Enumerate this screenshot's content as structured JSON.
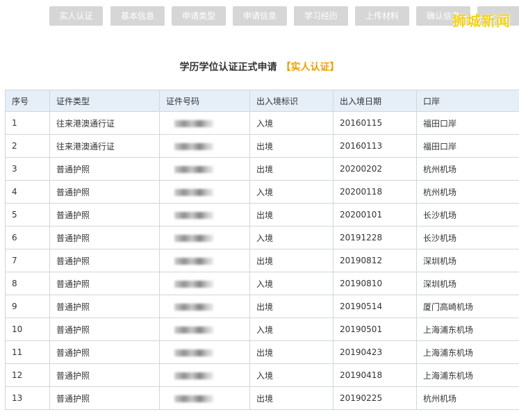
{
  "steps": [
    "实人认证",
    "基本信息",
    "申请类型",
    "申请信息",
    "学习经历",
    "上传材料",
    "确认信息"
  ],
  "watermark": "狮城新闻",
  "title": {
    "main": "学历学位认证正式申请",
    "tag": "【实人认证】"
  },
  "table": {
    "headers": [
      "序号",
      "证件类型",
      "证件号码",
      "出入境标识",
      "出入境日期",
      "口岸"
    ],
    "rows": [
      {
        "no": "1",
        "type": "往来港澳通行证",
        "flag": "入境",
        "date": "20160115",
        "port": "福田口岸"
      },
      {
        "no": "2",
        "type": "往来港澳通行证",
        "flag": "出境",
        "date": "20160113",
        "port": "福田口岸"
      },
      {
        "no": "3",
        "type": "普通护照",
        "flag": "出境",
        "date": "20200202",
        "port": "杭州机场"
      },
      {
        "no": "4",
        "type": "普通护照",
        "flag": "入境",
        "date": "20200118",
        "port": "杭州机场"
      },
      {
        "no": "5",
        "type": "普通护照",
        "flag": "出境",
        "date": "20200101",
        "port": "长沙机场"
      },
      {
        "no": "6",
        "type": "普通护照",
        "flag": "入境",
        "date": "20191228",
        "port": "长沙机场"
      },
      {
        "no": "7",
        "type": "普通护照",
        "flag": "出境",
        "date": "20190812",
        "port": "深圳机场"
      },
      {
        "no": "8",
        "type": "普通护照",
        "flag": "入境",
        "date": "20190810",
        "port": "深圳机场"
      },
      {
        "no": "9",
        "type": "普通护照",
        "flag": "出境",
        "date": "20190514",
        "port": "厦门高崎机场"
      },
      {
        "no": "10",
        "type": "普通护照",
        "flag": "入境",
        "date": "20190501",
        "port": "上海浦东机场"
      },
      {
        "no": "11",
        "type": "普通护照",
        "flag": "出境",
        "date": "20190423",
        "port": "上海浦东机场"
      },
      {
        "no": "12",
        "type": "普通护照",
        "flag": "入境",
        "date": "20190418",
        "port": "上海浦东机场"
      },
      {
        "no": "13",
        "type": "普通护照",
        "flag": "出境",
        "date": "20190225",
        "port": "杭州机场"
      }
    ]
  }
}
